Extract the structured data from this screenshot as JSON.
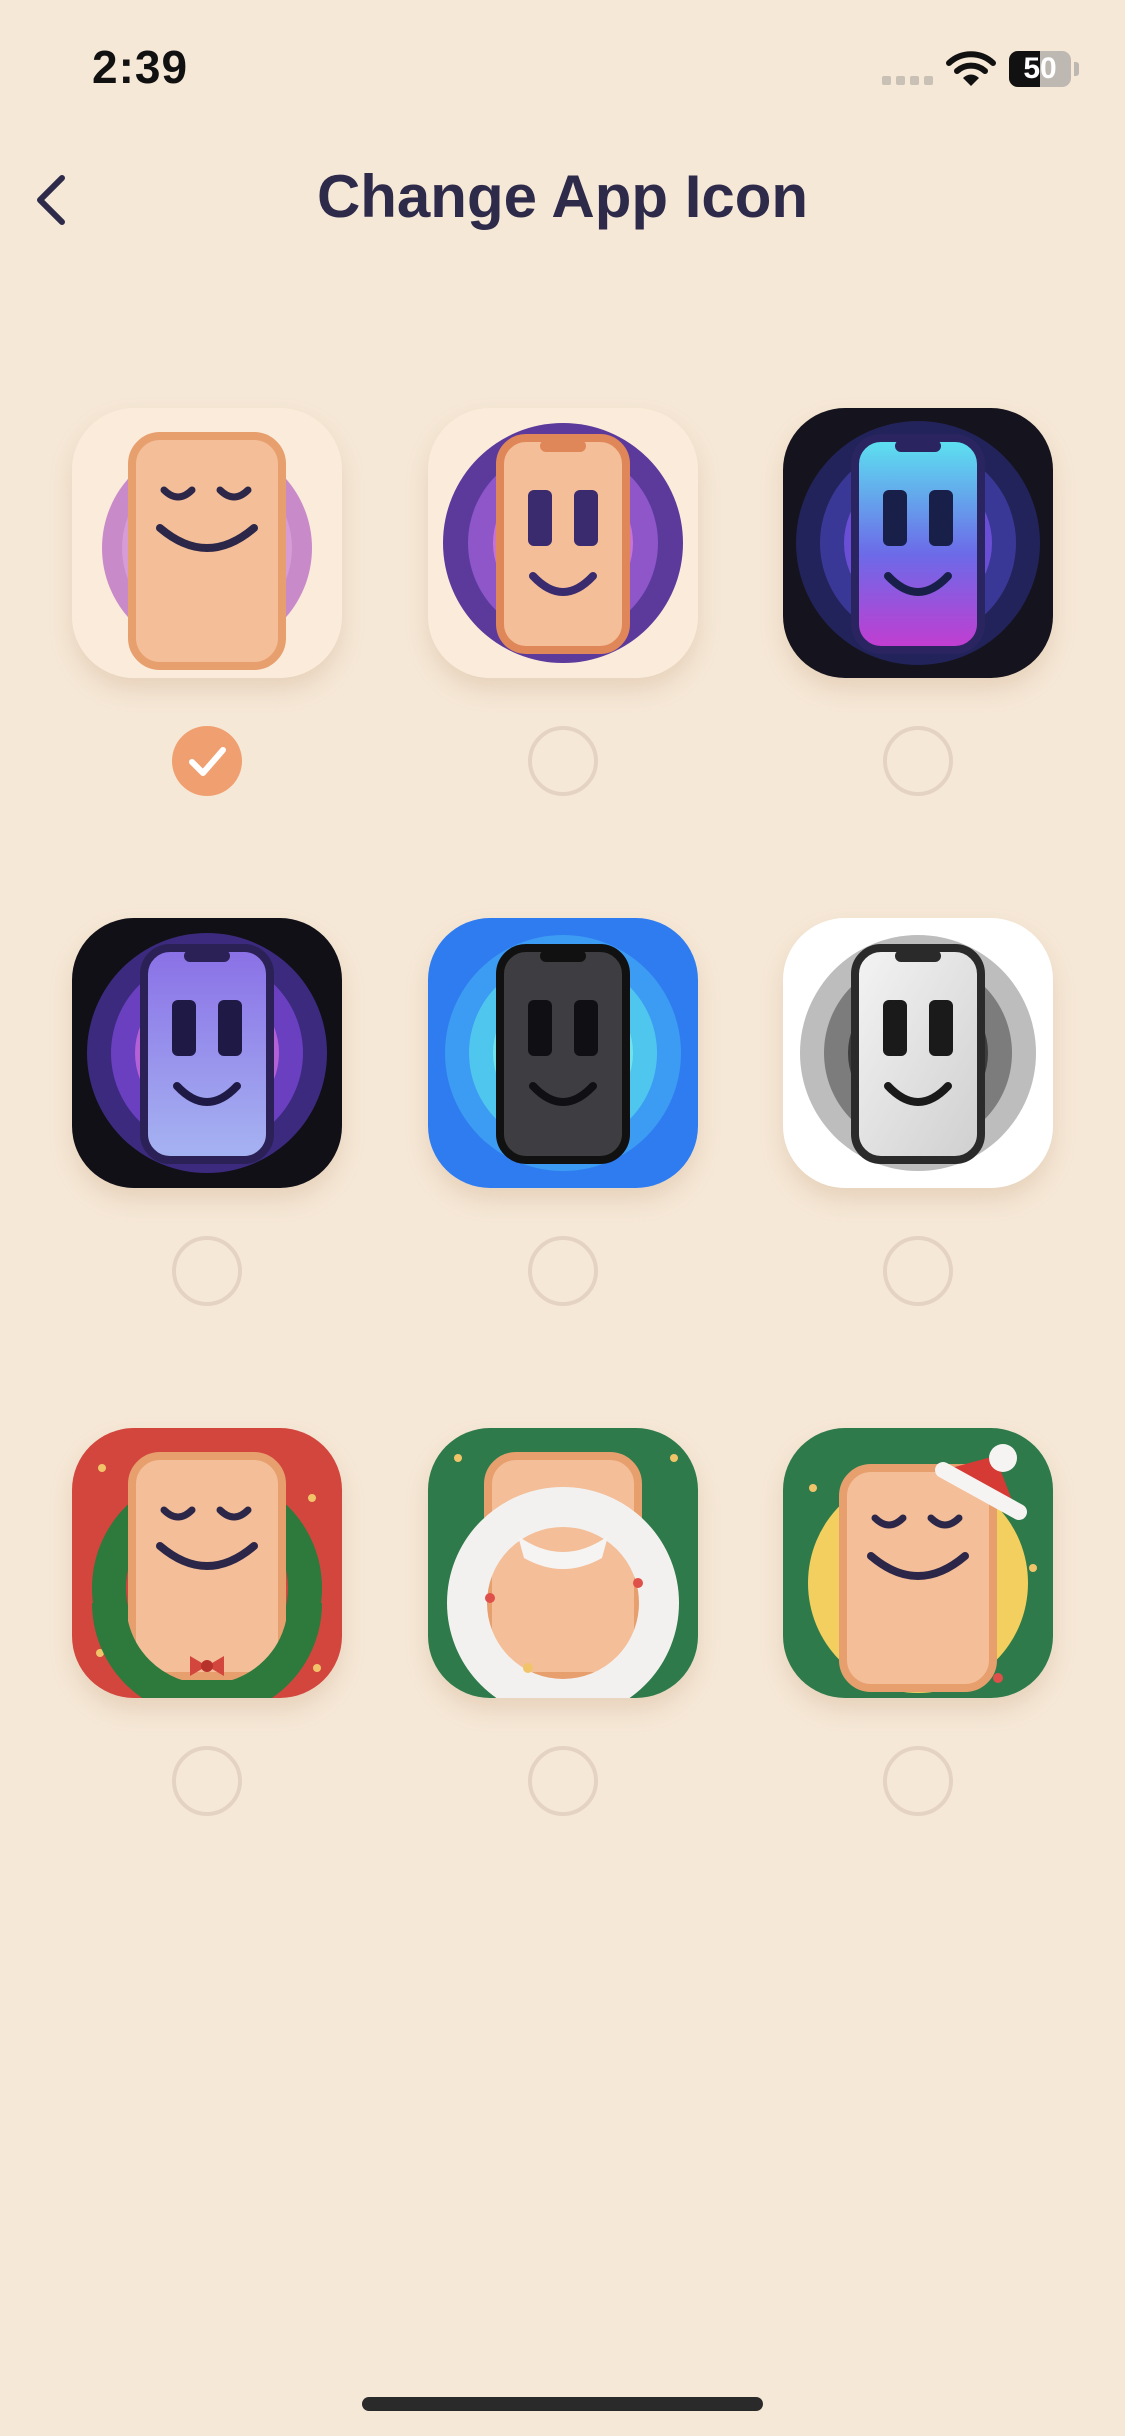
{
  "status_bar": {
    "time": "2:39",
    "battery_level": "50",
    "battery_fraction": 0.5,
    "icons": [
      "cellular-signal-icon",
      "wifi-icon",
      "battery-icon"
    ]
  },
  "header": {
    "title": "Change App Icon",
    "back_icon": "chevron-left-icon"
  },
  "colors": {
    "background": "#F6E8D7",
    "accent": "#F0A070",
    "title": "#2E2A4A"
  },
  "icon_options": [
    {
      "id": "classic-sleepy",
      "selected": true
    },
    {
      "id": "purple-smile-light",
      "selected": false
    },
    {
      "id": "neon-dark",
      "selected": false
    },
    {
      "id": "purple-dark",
      "selected": false
    },
    {
      "id": "blue-black-phone",
      "selected": false
    },
    {
      "id": "monochrome",
      "selected": false
    },
    {
      "id": "christmas-wreath",
      "selected": false
    },
    {
      "id": "santa-beard",
      "selected": false
    },
    {
      "id": "santa-hat",
      "selected": false
    }
  ]
}
